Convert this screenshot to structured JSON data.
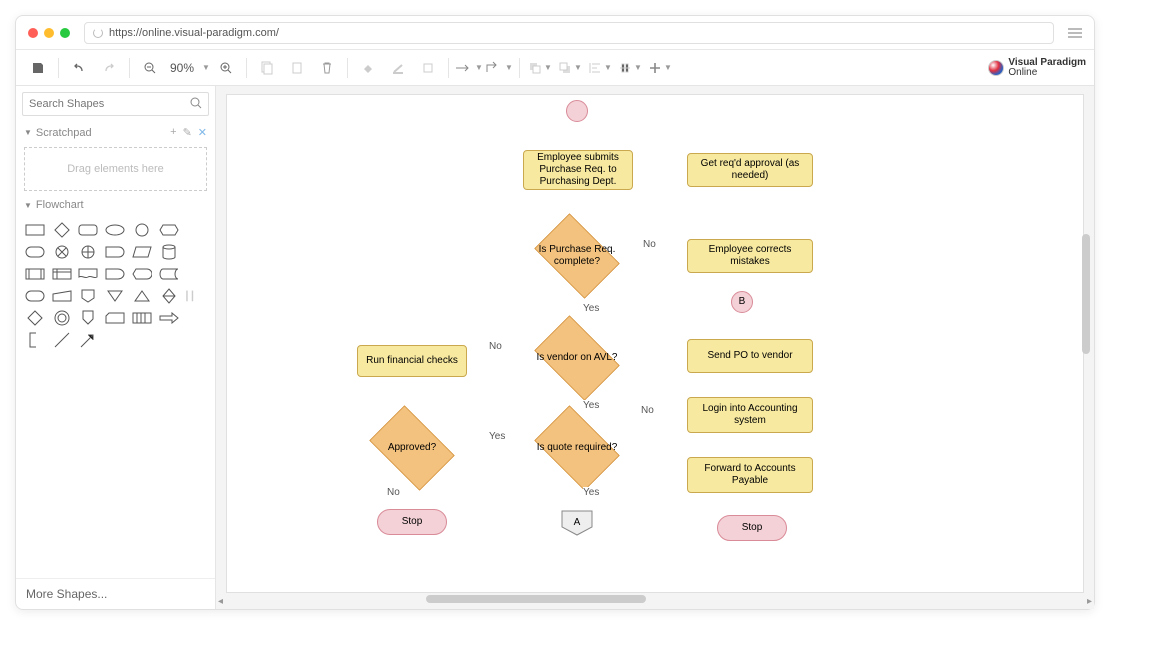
{
  "url": "https://online.visual-paradigm.com/",
  "toolbar": {
    "zoom": "90%"
  },
  "brand": {
    "line1": "Visual Paradigm",
    "line2": "Online"
  },
  "sidebar": {
    "search_placeholder": "Search Shapes",
    "scratchpad": "Scratchpad",
    "dropzone": "Drag elements here",
    "flowchart": "Flowchart",
    "more": "More Shapes..."
  },
  "nodes": {
    "submit": "Employee submits Purchase Req. to Purchasing Dept.",
    "approval": "Get req'd approval (as needed)",
    "complete": "Is Purchase Req. complete?",
    "corrects": "Employee corrects mistakes",
    "b": "B",
    "avl": "Is vendor on AVL?",
    "checks": "Run financial checks",
    "sendpo": "Send PO to vendor",
    "login": "Login into Accounting system",
    "approved": "Approved?",
    "quote": "Is quote required?",
    "forward": "Forward to Accounts Payable",
    "stop1": "Stop",
    "stop2": "Stop",
    "a": "A"
  },
  "labels": {
    "no1": "No",
    "yes1": "Yes",
    "no2": "No",
    "yes2": "Yes",
    "no3": "No",
    "yes3": "Yes",
    "no4": "No",
    "yes4": "Yes"
  }
}
